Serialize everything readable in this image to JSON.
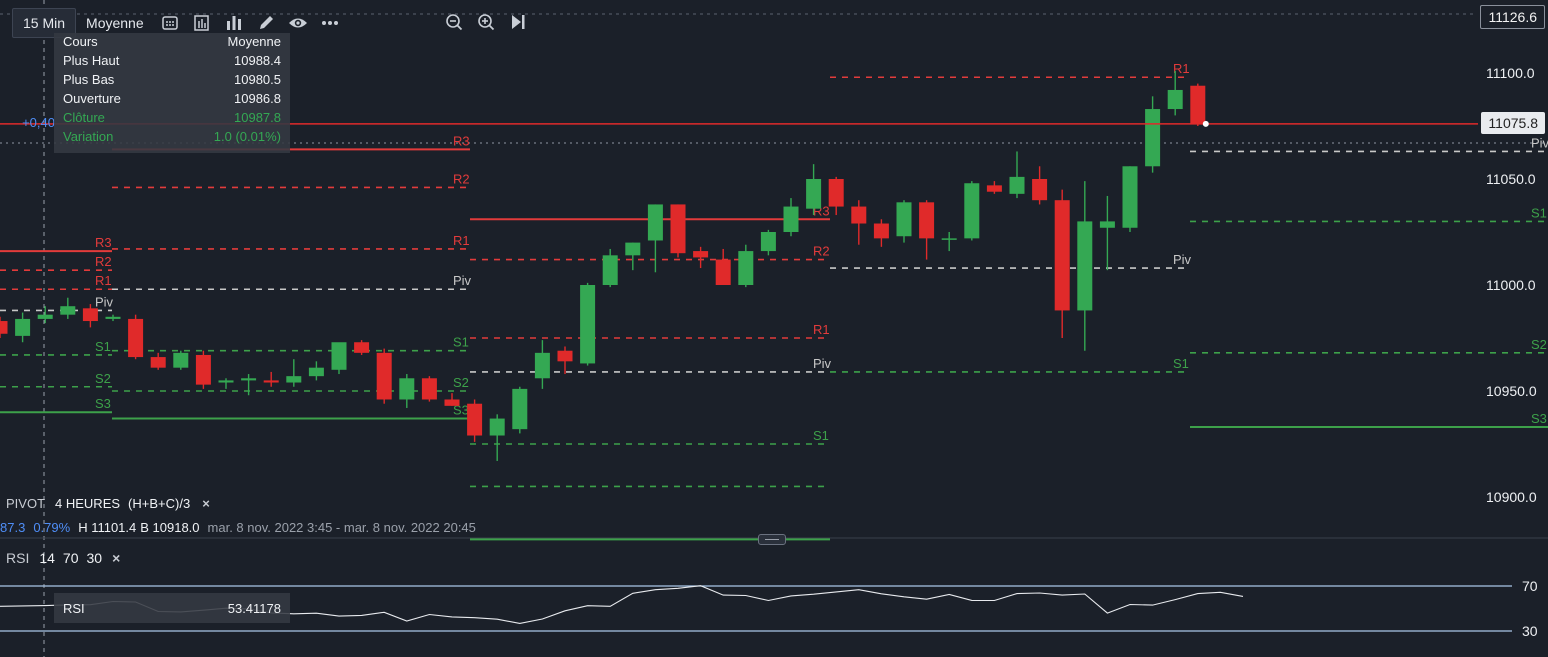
{
  "toolbar": {
    "timeframe": "15 Min",
    "chart_style": "Moyenne",
    "icons": [
      "screenshot-icon",
      "layout-icon",
      "indicators-icon",
      "draw-icon",
      "visibility-icon",
      "more-icon"
    ],
    "zoom_icons": [
      "zoom-out-icon",
      "zoom-in-icon",
      "jump-to-latest-icon"
    ]
  },
  "ohlc": {
    "header_label": "Cours",
    "header_value": "Moyenne",
    "high_label": "Plus Haut",
    "high": "10988.4",
    "low_label": "Plus Bas",
    "low": "10980.5",
    "open_label": "Ouverture",
    "open": "10986.8",
    "close_label": "Clôture",
    "close": "10987.8",
    "change_label": "Variation",
    "change": "1.0 (0.01%)"
  },
  "left_change_tag": "+0,40",
  "price_tags": {
    "top": "11126.6",
    "current": "11075.8"
  },
  "pivot_indicator": {
    "name": "PIVOT",
    "period": "4 HEURES",
    "formula": "(H+B+C)/3",
    "close_icon": "×"
  },
  "stats": {
    "last_partial": "87.3",
    "change_pct": "0.79%",
    "high": "H 11101.4",
    "low": "B 10918.0",
    "range": "mar. 8 nov. 2022 3:45 - mar. 8 nov. 2022 20:45"
  },
  "rsi": {
    "name": "RSI",
    "p1": "14",
    "p2": "70",
    "p3": "30",
    "close_icon": "×",
    "label": "RSI",
    "value": "53.41178"
  },
  "colors": {
    "bg": "#1b2029",
    "up": "#34a853",
    "down": "#e02a2a",
    "resistance": "#e23b3b",
    "support": "#3da14a",
    "pivot": "#c8c8c8",
    "rsi_bands": "#a9c6e8"
  },
  "chart_data": {
    "type": "candlestick",
    "y_axis": {
      "ticks": [
        11100.0,
        11050.0,
        11000.0,
        10950.0,
        10900.0
      ],
      "range": [
        10880,
        11135
      ]
    },
    "candles": [
      {
        "o": 10983,
        "h": 10985,
        "l": 10975,
        "c": 10977
      },
      {
        "o": 10976,
        "h": 10987,
        "l": 10973,
        "c": 10984
      },
      {
        "o": 10984,
        "h": 10990,
        "l": 10982,
        "c": 10986
      },
      {
        "o": 10986,
        "h": 10994,
        "l": 10984,
        "c": 10990
      },
      {
        "o": 10989,
        "h": 10991,
        "l": 10980,
        "c": 10983
      },
      {
        "o": 10984,
        "h": 10986,
        "l": 10983,
        "c": 10985
      },
      {
        "o": 10984,
        "h": 10986,
        "l": 10965,
        "c": 10966
      },
      {
        "o": 10966,
        "h": 10968,
        "l": 10960,
        "c": 10961
      },
      {
        "o": 10961,
        "h": 10969,
        "l": 10960,
        "c": 10968
      },
      {
        "o": 10967,
        "h": 10969,
        "l": 10951,
        "c": 10953
      },
      {
        "o": 10954,
        "h": 10956,
        "l": 10951,
        "c": 10955
      },
      {
        "o": 10955,
        "h": 10958,
        "l": 10948,
        "c": 10956
      },
      {
        "o": 10955,
        "h": 10959,
        "l": 10952,
        "c": 10954
      },
      {
        "o": 10954,
        "h": 10965,
        "l": 10952,
        "c": 10957
      },
      {
        "o": 10957,
        "h": 10964,
        "l": 10955,
        "c": 10961
      },
      {
        "o": 10960,
        "h": 10972,
        "l": 10958,
        "c": 10973
      },
      {
        "o": 10973,
        "h": 10974,
        "l": 10967,
        "c": 10968
      },
      {
        "o": 10968,
        "h": 10970,
        "l": 10944,
        "c": 10946
      },
      {
        "o": 10946,
        "h": 10958,
        "l": 10942,
        "c": 10956
      },
      {
        "o": 10956,
        "h": 10957,
        "l": 10945,
        "c": 10946
      },
      {
        "o": 10946,
        "h": 10949,
        "l": 10943,
        "c": 10943
      },
      {
        "o": 10944,
        "h": 10946,
        "l": 10926,
        "c": 10929
      },
      {
        "o": 10929,
        "h": 10939,
        "l": 10917,
        "c": 10937
      },
      {
        "o": 10932,
        "h": 10952,
        "l": 10930,
        "c": 10951
      },
      {
        "o": 10956,
        "h": 10974,
        "l": 10951,
        "c": 10968
      },
      {
        "o": 10969,
        "h": 10971,
        "l": 10958,
        "c": 10964
      },
      {
        "o": 10963,
        "h": 11001,
        "l": 10962,
        "c": 11000
      },
      {
        "o": 11000,
        "h": 11017,
        "l": 10999,
        "c": 11014
      },
      {
        "o": 11014,
        "h": 11020,
        "l": 11007,
        "c": 11020
      },
      {
        "o": 11021,
        "h": 11038,
        "l": 11006,
        "c": 11038
      },
      {
        "o": 11038,
        "h": 11038,
        "l": 11013,
        "c": 11015
      },
      {
        "o": 11016,
        "h": 11018,
        "l": 11008,
        "c": 11013
      },
      {
        "o": 11012,
        "h": 11017,
        "l": 11002,
        "c": 11000
      },
      {
        "o": 11000,
        "h": 11019,
        "l": 10999,
        "c": 11016
      },
      {
        "o": 11016,
        "h": 11026,
        "l": 11014,
        "c": 11025
      },
      {
        "o": 11025,
        "h": 11041,
        "l": 11023,
        "c": 11037
      },
      {
        "o": 11036,
        "h": 11057,
        "l": 11033,
        "c": 11050
      },
      {
        "o": 11050,
        "h": 11051,
        "l": 11033,
        "c": 11037
      },
      {
        "o": 11037,
        "h": 11040,
        "l": 11019,
        "c": 11029
      },
      {
        "o": 11029,
        "h": 11031,
        "l": 11018,
        "c": 11022
      },
      {
        "o": 11023,
        "h": 11040,
        "l": 11020,
        "c": 11039
      },
      {
        "o": 11039,
        "h": 11040,
        "l": 11012,
        "c": 11022
      },
      {
        "o": 11022,
        "h": 11025,
        "l": 11016,
        "c": 11022
      },
      {
        "o": 11022,
        "h": 11049,
        "l": 11021,
        "c": 11048
      },
      {
        "o": 11047,
        "h": 11049,
        "l": 11043,
        "c": 11044
      },
      {
        "o": 11043,
        "h": 11063,
        "l": 11041,
        "c": 11051
      },
      {
        "o": 11050,
        "h": 11056,
        "l": 11038,
        "c": 11040
      },
      {
        "o": 11040,
        "h": 11045,
        "l": 10975,
        "c": 10988
      },
      {
        "o": 10988,
        "h": 11049,
        "l": 10969,
        "c": 11030
      },
      {
        "o": 11027,
        "h": 11042,
        "l": 11007,
        "c": 11030
      },
      {
        "o": 11027,
        "h": 11056,
        "l": 11025,
        "c": 11056
      },
      {
        "o": 11056,
        "h": 11089,
        "l": 11053,
        "c": 11083
      },
      {
        "o": 11083,
        "h": 11101,
        "l": 11080,
        "c": 11092
      },
      {
        "o": 11094,
        "h": 11095,
        "l": 11075,
        "c": 11076
      }
    ],
    "pivot_sets": [
      {
        "levels": {
          "R3": 11016,
          "R2": 11007,
          "R1": 10998,
          "Piv": 10988,
          "S1": 10967,
          "S2": 10952,
          "S3": 10940
        }
      },
      {
        "levels": {
          "R3": 11064,
          "R2": 11046,
          "R1": 11017,
          "Piv": 10998,
          "S1": 10969,
          "S2": 10950,
          "S3": 10937
        }
      },
      {
        "levels": {
          "R3": 11031,
          "R2": 11012,
          "R1": 10975,
          "Piv": 10959,
          "S1": 10925,
          "S2": 10905,
          "S3": 10880
        }
      },
      {
        "levels": {
          "R1": 11098,
          "Piv": 11008,
          "S1": 10959
        }
      },
      {
        "levels": {
          "R1": 11135,
          "Piv": 11063,
          "S1": 11030,
          "S2": 10968,
          "S3": 10933
        }
      }
    ],
    "rsi_series": [
      52.6,
      53.2,
      53.4,
      56.2,
      55.8,
      47.3,
      47.0,
      48.5,
      50.3,
      49.6,
      46.1,
      45.3,
      45.8,
      43.2,
      43.9,
      46.6,
      38.9,
      44.7,
      42.5,
      41.8,
      40.5,
      36.8,
      40.7,
      48.0,
      52.5,
      52.0,
      63.5,
      66.7,
      68.0,
      70.3,
      61.9,
      61.6,
      57.1,
      61.2,
      62.7,
      64.8,
      66.7,
      63.1,
      60.4,
      58.3,
      62.4,
      57.2,
      57.1,
      63.2,
      63.8,
      61.9,
      62.9,
      45.9,
      53.6,
      53.0,
      57.9,
      63.2,
      64.4,
      60.8
    ],
    "rsi_levels": [
      70,
      30
    ],
    "rsi_current": 53.41178
  }
}
